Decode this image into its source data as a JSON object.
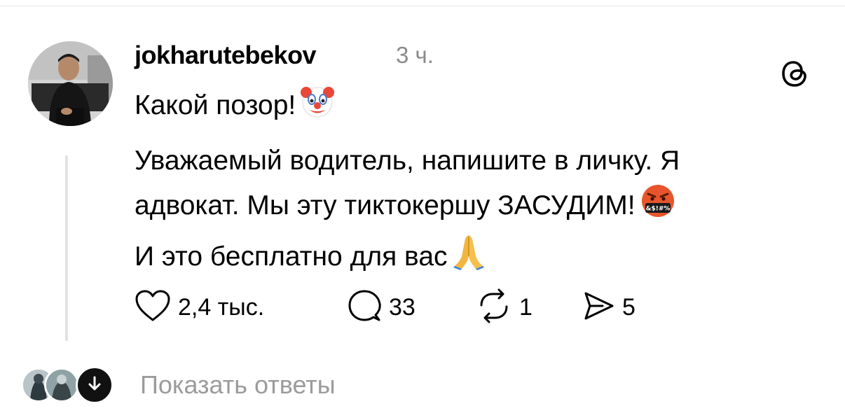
{
  "post": {
    "username": "jokharutebekov",
    "timestamp": "3 ч.",
    "lines": [
      "Какой позор!",
      "Уважаемый водитель, напишите в личку. Я",
      "адвокат. Мы эту тиктокершу ЗАСУДИМ!",
      "И это бесплатно для вас"
    ],
    "emojis": {
      "line1": "clown-face-emoji",
      "line3": "face-with-symbols-on-mouth-emoji",
      "line4": "folded-hands-emoji"
    },
    "emoji_grawlix_text": "&$!#%"
  },
  "actions": {
    "likes": "2,4 тыс.",
    "replies": "33",
    "reposts": "1",
    "shares": "5"
  },
  "icons": {
    "app": "threads-icon",
    "like": "heart-icon",
    "reply": "comment-bubble-icon",
    "repost": "repost-icon",
    "share": "share-arrow-icon",
    "expand": "arrow-down-icon"
  },
  "footer": {
    "show_replies_label": "Показать ответы"
  },
  "colors": {
    "text": "#000000",
    "secondary_text": "#8a8a8a",
    "thread_line": "#e2e2e2",
    "show_replies_text": "#9b9b9b",
    "expand_button_bg": "#111111"
  }
}
